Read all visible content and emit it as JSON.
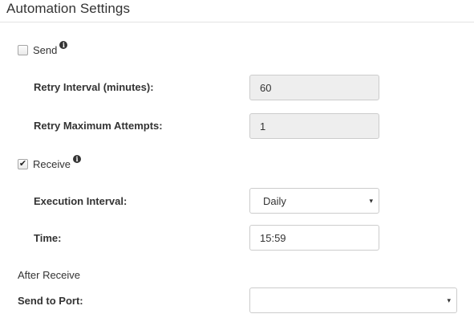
{
  "section": {
    "title": "Automation Settings"
  },
  "send": {
    "label": "Send",
    "checked": false,
    "info_icon": "info-circle-icon",
    "retry_interval": {
      "label": "Retry Interval (minutes):",
      "value": "60",
      "disabled": true
    },
    "retry_max": {
      "label": "Retry Maximum Attempts:",
      "value": "1",
      "disabled": true
    }
  },
  "receive": {
    "label": "Receive",
    "checked": true,
    "checkmark": "✔",
    "info_icon": "info-circle-icon",
    "execution_interval": {
      "label": "Execution Interval:",
      "value": "Daily"
    },
    "time": {
      "label": "Time:",
      "value": "15:59"
    }
  },
  "after_receive": {
    "heading": "After Receive",
    "send_to_port": {
      "label": "Send to Port:",
      "value": ""
    }
  },
  "icons": {
    "caret": "▾",
    "info": "i"
  },
  "colors": {
    "disabled_bg": "#eeeeee",
    "border": "#cccccc",
    "text": "#333333"
  }
}
